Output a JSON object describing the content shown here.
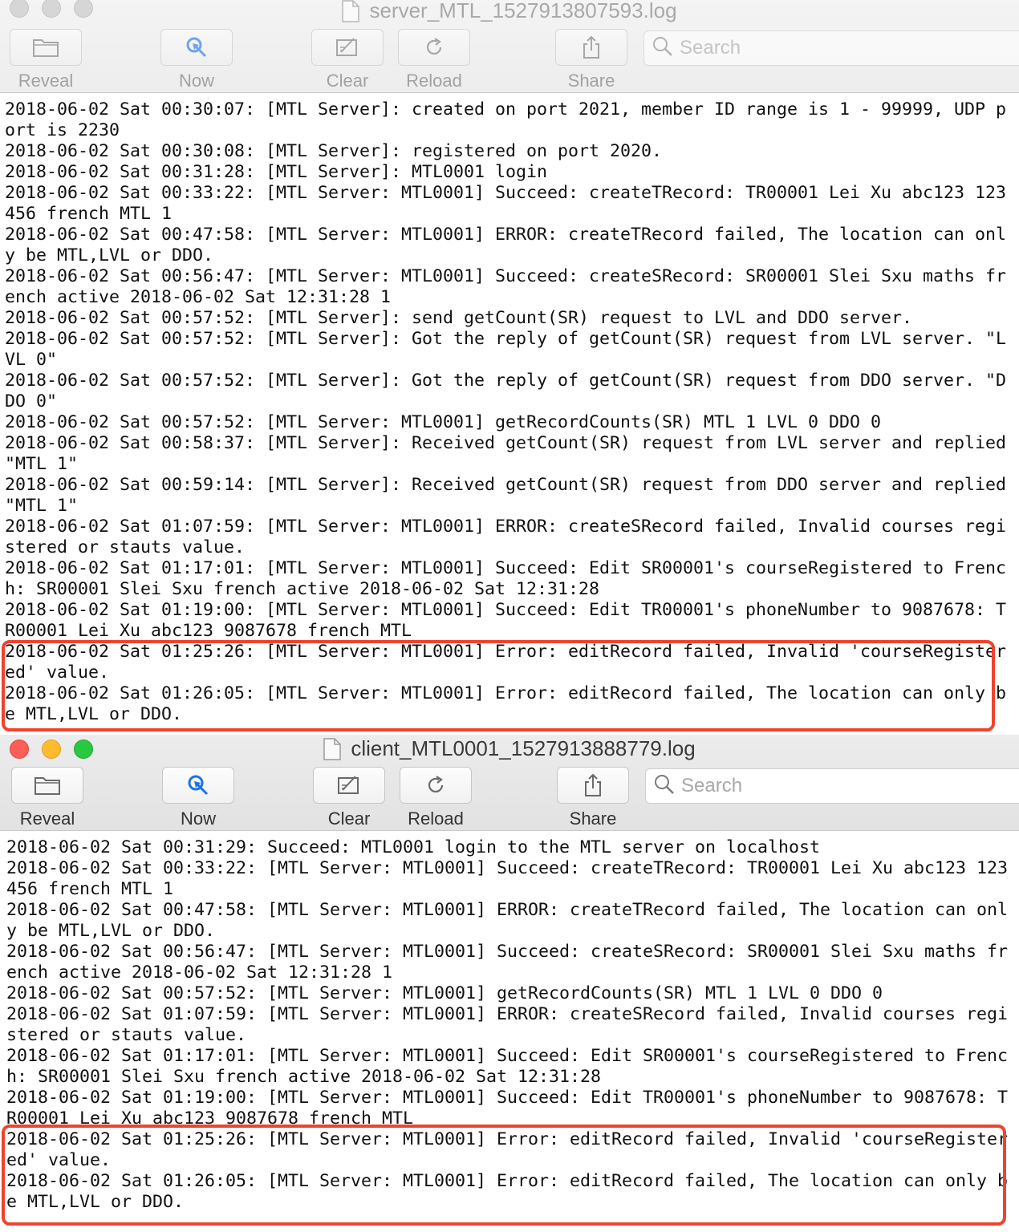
{
  "server_window": {
    "title": "server_MTL_1527913807593.log",
    "toolbar": {
      "reveal": "Reveal",
      "now": "Now",
      "clear": "Clear",
      "reload": "Reload",
      "share": "Share",
      "search_placeholder": "Search"
    },
    "lines": [
      "2018-06-02 Sat 00:30:07: [MTL Server]: created on port 2021, member ID range is 1 - 99999, UDP port is 2230",
      "2018-06-02 Sat 00:30:08: [MTL Server]: registered on port 2020.",
      "2018-06-02 Sat 00:31:28: [MTL Server]: MTL0001 login",
      "2018-06-02 Sat 00:33:22: [MTL Server: MTL0001] Succeed: createTRecord: TR00001 Lei Xu abc123 123456 french MTL 1",
      "2018-06-02 Sat 00:47:58: [MTL Server: MTL0001] ERROR: createTRecord failed, The location can only be MTL,LVL or DDO.",
      "2018-06-02 Sat 00:56:47: [MTL Server: MTL0001] Succeed: createSRecord: SR00001 Slei Sxu maths french active 2018-06-02 Sat 12:31:28 1",
      "2018-06-02 Sat 00:57:52: [MTL Server]: send getCount(SR) request to LVL and DDO server.",
      "2018-06-02 Sat 00:57:52: [MTL Server]: Got the reply of getCount(SR) request from LVL server. \"LVL 0\"",
      "2018-06-02 Sat 00:57:52: [MTL Server]: Got the reply of getCount(SR) request from DDO server. \"DDO 0\"",
      "2018-06-02 Sat 00:57:52: [MTL Server: MTL0001] getRecordCounts(SR) MTL 1 LVL 0 DDO 0",
      "2018-06-02 Sat 00:58:37: [MTL Server]: Received getCount(SR) request from LVL server and replied \"MTL 1\"",
      "2018-06-02 Sat 00:59:14: [MTL Server]: Received getCount(SR) request from DDO server and replied \"MTL 1\"",
      "2018-06-02 Sat 01:07:59: [MTL Server: MTL0001] ERROR: createSRecord failed, Invalid courses registered or stauts value.",
      "2018-06-02 Sat 01:17:01: [MTL Server: MTL0001] Succeed: Edit SR00001's courseRegistered to French: SR00001 Slei Sxu french active 2018-06-02 Sat 12:31:28",
      "2018-06-02 Sat 01:19:00: [MTL Server: MTL0001] Succeed: Edit TR00001's phoneNumber to 9087678: TR00001 Lei Xu abc123 9087678 french MTL",
      "2018-06-02 Sat 01:25:26: [MTL Server: MTL0001] Error: editRecord failed, Invalid 'courseRegistered' value.",
      "2018-06-02 Sat 01:26:05: [MTL Server: MTL0001] Error: editRecord failed, The location can only be MTL,LVL or DDO."
    ]
  },
  "client_window": {
    "title": "client_MTL0001_1527913888779.log",
    "toolbar": {
      "reveal": "Reveal",
      "now": "Now",
      "clear": "Clear",
      "reload": "Reload",
      "share": "Share",
      "search_placeholder": "Search"
    },
    "lines": [
      "2018-06-02 Sat 00:31:29: Succeed: MTL0001 login to the MTL server on localhost",
      "2018-06-02 Sat 00:33:22: [MTL Server: MTL0001] Succeed: createTRecord: TR00001 Lei Xu abc123 123456 french MTL 1",
      "2018-06-02 Sat 00:47:58: [MTL Server: MTL0001] ERROR: createTRecord failed, The location can only be MTL,LVL or DDO.",
      "2018-06-02 Sat 00:56:47: [MTL Server: MTL0001] Succeed: createSRecord: SR00001 Slei Sxu maths french active 2018-06-02 Sat 12:31:28 1",
      "2018-06-02 Sat 00:57:52: [MTL Server: MTL0001] getRecordCounts(SR) MTL 1 LVL 0 DDO 0",
      "2018-06-02 Sat 01:07:59: [MTL Server: MTL0001] ERROR: createSRecord failed, Invalid courses registered or stauts value.",
      "2018-06-02 Sat 01:17:01: [MTL Server: MTL0001] Succeed: Edit SR00001's courseRegistered to French: SR00001 Slei Sxu french active 2018-06-02 Sat 12:31:28",
      "2018-06-02 Sat 01:19:00: [MTL Server: MTL0001] Succeed: Edit TR00001's phoneNumber to 9087678: TR00001 Lei Xu abc123 9087678 french MTL",
      "2018-06-02 Sat 01:25:26: [MTL Server: MTL0001] Error: editRecord failed, Invalid 'courseRegistered' value.",
      "2018-06-02 Sat 01:26:05: [MTL Server: MTL0001] Error: editRecord failed, The location can only be MTL,LVL or DDO."
    ]
  },
  "colors": {
    "highlight": "#f0432d",
    "close": "#fc5f57",
    "minimize": "#fdbc2e",
    "zoom": "#28c840",
    "now_icon": "#1a73e8"
  },
  "icons": [
    "folder-icon",
    "now-target-icon",
    "clear-icon",
    "reload-icon",
    "share-icon",
    "search-icon",
    "document-icon"
  ]
}
